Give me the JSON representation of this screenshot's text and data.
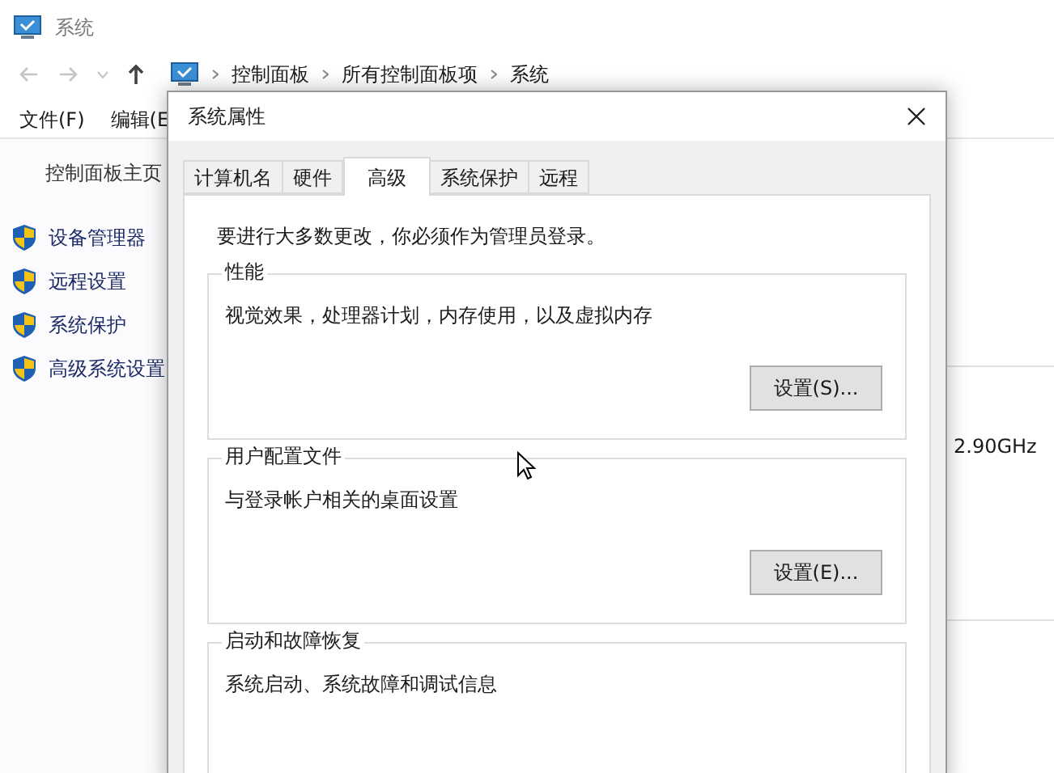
{
  "window": {
    "title": "系统",
    "breadcrumb": [
      "控制面板",
      "所有控制面板项",
      "系统"
    ],
    "menu": [
      "文件(F)",
      "编辑(E"
    ],
    "sidebar": {
      "home": "控制面板主页",
      "items": [
        "设备管理器",
        "远程设置",
        "系统保护",
        "高级系统设置"
      ]
    },
    "main": {
      "processor_speed": "2.90GHz"
    }
  },
  "dialog": {
    "title": "系统属性",
    "tabs": [
      {
        "label": "计算机名",
        "selected": false
      },
      {
        "label": "硬件",
        "selected": false
      },
      {
        "label": "高级",
        "selected": true
      },
      {
        "label": "系统保护",
        "selected": false
      },
      {
        "label": "远程",
        "selected": false
      }
    ],
    "notice": "要进行大多数更改，你必须作为管理员登录。",
    "groups": [
      {
        "title": "性能",
        "description": "视觉效果，处理器计划，内存使用，以及虚拟内存",
        "button": "设置(S)..."
      },
      {
        "title": "用户配置文件",
        "description": "与登录帐户相关的桌面设置",
        "button": "设置(E)..."
      },
      {
        "title": "启动和故障恢复",
        "description": "系统启动、系统故障和调试信息"
      }
    ]
  }
}
